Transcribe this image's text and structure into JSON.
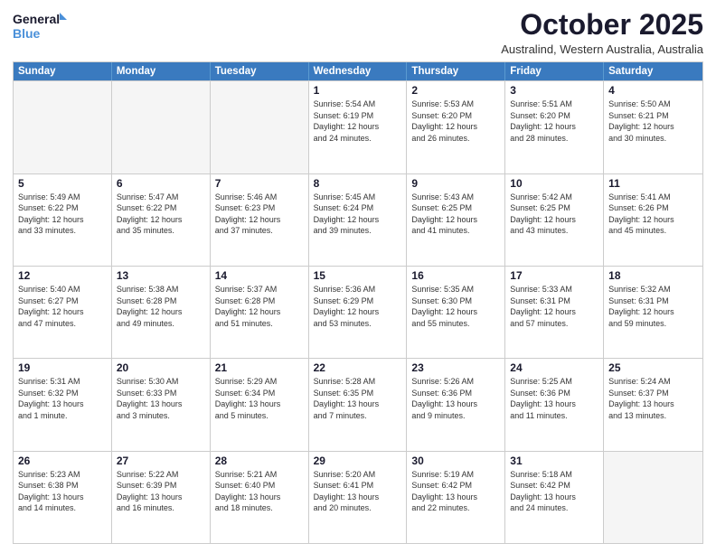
{
  "logo": {
    "line1": "General",
    "line2": "Blue"
  },
  "title": "October 2025",
  "subtitle": "Australind, Western Australia, Australia",
  "headers": [
    "Sunday",
    "Monday",
    "Tuesday",
    "Wednesday",
    "Thursday",
    "Friday",
    "Saturday"
  ],
  "rows": [
    [
      {
        "day": "",
        "empty": true
      },
      {
        "day": "",
        "empty": true
      },
      {
        "day": "",
        "empty": true
      },
      {
        "day": "1",
        "info": "Sunrise: 5:54 AM\nSunset: 6:19 PM\nDaylight: 12 hours\nand 24 minutes."
      },
      {
        "day": "2",
        "info": "Sunrise: 5:53 AM\nSunset: 6:20 PM\nDaylight: 12 hours\nand 26 minutes."
      },
      {
        "day": "3",
        "info": "Sunrise: 5:51 AM\nSunset: 6:20 PM\nDaylight: 12 hours\nand 28 minutes."
      },
      {
        "day": "4",
        "info": "Sunrise: 5:50 AM\nSunset: 6:21 PM\nDaylight: 12 hours\nand 30 minutes."
      }
    ],
    [
      {
        "day": "5",
        "info": "Sunrise: 5:49 AM\nSunset: 6:22 PM\nDaylight: 12 hours\nand 33 minutes."
      },
      {
        "day": "6",
        "info": "Sunrise: 5:47 AM\nSunset: 6:22 PM\nDaylight: 12 hours\nand 35 minutes."
      },
      {
        "day": "7",
        "info": "Sunrise: 5:46 AM\nSunset: 6:23 PM\nDaylight: 12 hours\nand 37 minutes."
      },
      {
        "day": "8",
        "info": "Sunrise: 5:45 AM\nSunset: 6:24 PM\nDaylight: 12 hours\nand 39 minutes."
      },
      {
        "day": "9",
        "info": "Sunrise: 5:43 AM\nSunset: 6:25 PM\nDaylight: 12 hours\nand 41 minutes."
      },
      {
        "day": "10",
        "info": "Sunrise: 5:42 AM\nSunset: 6:25 PM\nDaylight: 12 hours\nand 43 minutes."
      },
      {
        "day": "11",
        "info": "Sunrise: 5:41 AM\nSunset: 6:26 PM\nDaylight: 12 hours\nand 45 minutes."
      }
    ],
    [
      {
        "day": "12",
        "info": "Sunrise: 5:40 AM\nSunset: 6:27 PM\nDaylight: 12 hours\nand 47 minutes."
      },
      {
        "day": "13",
        "info": "Sunrise: 5:38 AM\nSunset: 6:28 PM\nDaylight: 12 hours\nand 49 minutes."
      },
      {
        "day": "14",
        "info": "Sunrise: 5:37 AM\nSunset: 6:28 PM\nDaylight: 12 hours\nand 51 minutes."
      },
      {
        "day": "15",
        "info": "Sunrise: 5:36 AM\nSunset: 6:29 PM\nDaylight: 12 hours\nand 53 minutes."
      },
      {
        "day": "16",
        "info": "Sunrise: 5:35 AM\nSunset: 6:30 PM\nDaylight: 12 hours\nand 55 minutes."
      },
      {
        "day": "17",
        "info": "Sunrise: 5:33 AM\nSunset: 6:31 PM\nDaylight: 12 hours\nand 57 minutes."
      },
      {
        "day": "18",
        "info": "Sunrise: 5:32 AM\nSunset: 6:31 PM\nDaylight: 12 hours\nand 59 minutes."
      }
    ],
    [
      {
        "day": "19",
        "info": "Sunrise: 5:31 AM\nSunset: 6:32 PM\nDaylight: 13 hours\nand 1 minute."
      },
      {
        "day": "20",
        "info": "Sunrise: 5:30 AM\nSunset: 6:33 PM\nDaylight: 13 hours\nand 3 minutes."
      },
      {
        "day": "21",
        "info": "Sunrise: 5:29 AM\nSunset: 6:34 PM\nDaylight: 13 hours\nand 5 minutes."
      },
      {
        "day": "22",
        "info": "Sunrise: 5:28 AM\nSunset: 6:35 PM\nDaylight: 13 hours\nand 7 minutes."
      },
      {
        "day": "23",
        "info": "Sunrise: 5:26 AM\nSunset: 6:36 PM\nDaylight: 13 hours\nand 9 minutes."
      },
      {
        "day": "24",
        "info": "Sunrise: 5:25 AM\nSunset: 6:36 PM\nDaylight: 13 hours\nand 11 minutes."
      },
      {
        "day": "25",
        "info": "Sunrise: 5:24 AM\nSunset: 6:37 PM\nDaylight: 13 hours\nand 13 minutes."
      }
    ],
    [
      {
        "day": "26",
        "info": "Sunrise: 5:23 AM\nSunset: 6:38 PM\nDaylight: 13 hours\nand 14 minutes."
      },
      {
        "day": "27",
        "info": "Sunrise: 5:22 AM\nSunset: 6:39 PM\nDaylight: 13 hours\nand 16 minutes."
      },
      {
        "day": "28",
        "info": "Sunrise: 5:21 AM\nSunset: 6:40 PM\nDaylight: 13 hours\nand 18 minutes."
      },
      {
        "day": "29",
        "info": "Sunrise: 5:20 AM\nSunset: 6:41 PM\nDaylight: 13 hours\nand 20 minutes."
      },
      {
        "day": "30",
        "info": "Sunrise: 5:19 AM\nSunset: 6:42 PM\nDaylight: 13 hours\nand 22 minutes."
      },
      {
        "day": "31",
        "info": "Sunrise: 5:18 AM\nSunset: 6:42 PM\nDaylight: 13 hours\nand 24 minutes."
      },
      {
        "day": "",
        "empty": true
      }
    ]
  ]
}
